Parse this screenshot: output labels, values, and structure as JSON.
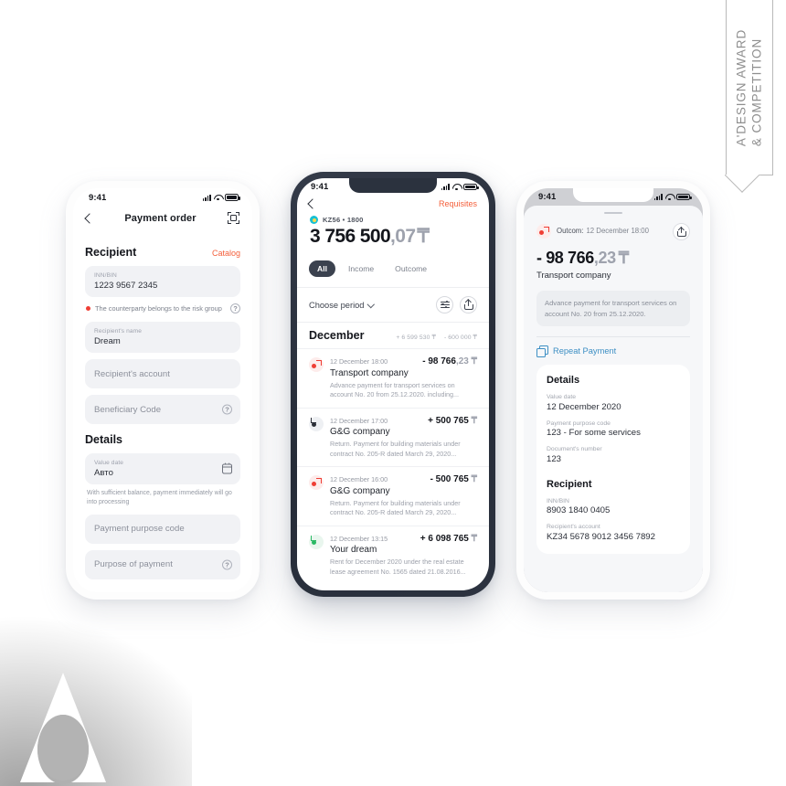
{
  "award": {
    "ribbon_line1": "A'DESIGN AWARD",
    "ribbon_line2": "& COMPETITION"
  },
  "phone_left": {
    "status": {
      "time": "9:41",
      "signal_icon": "signal-icon",
      "wifi_icon": "wifi-icon",
      "battery_icon": "battery-icon"
    },
    "navbar": {
      "back_icon": "chevron-left-icon",
      "title": "Payment order",
      "scan_icon": "scan-frame-icon"
    },
    "recipient": {
      "title": "Recipient",
      "action": "Catalog",
      "inn_label": "INN/BIN",
      "inn_value": "1223 9567 2345",
      "risk_text": "The counterparty belongs to the risk group",
      "risk_help_icon": "question-icon",
      "name_label": "Recipient's name",
      "name_value": "Dream",
      "account_placeholder": "Recipient's account",
      "beneficiary_placeholder": "Beneficiary Code",
      "beneficiary_help_icon": "question-icon"
    },
    "details": {
      "title": "Details",
      "value_date_label": "Value date",
      "value_date_value": "Авто",
      "calendar_icon": "calendar-icon",
      "hint": "With sufficient balance, payment immediately will go into processing",
      "purpose_code_placeholder": "Payment purpose code",
      "purpose_placeholder": "Purpose of payment",
      "purpose_help_icon": "question-icon"
    }
  },
  "phone_center": {
    "status": {
      "time": "9:41"
    },
    "navbar": {
      "back_icon": "chevron-left-icon",
      "requisites": "Requisites"
    },
    "account": {
      "badge_icon": "account-dot-icon",
      "name": "KZ56 • 1800",
      "balance_int": "3 756 500",
      "balance_dec": ",07",
      "currency": "₸"
    },
    "segments": [
      {
        "label": "All",
        "active": true
      },
      {
        "label": "Income",
        "active": false
      },
      {
        "label": "Outcome",
        "active": false
      }
    ],
    "period": {
      "label": "Choose period",
      "chevron_icon": "chevron-down-icon",
      "filter_icon": "sliders-icon",
      "share_icon": "share-upload-icon"
    },
    "month": {
      "name": "December",
      "income_total": "+ 6 599 530 ₸",
      "outcome_total": "- 600 000 ₸"
    },
    "transactions": [
      {
        "direction": "out",
        "time": "12 December 18:00",
        "amount_main": "- 98 766",
        "amount_dec": ",23",
        "currency": "₸",
        "name": "Transport company",
        "description": "Advance payment for transport services on account No. 20 from 25.12.2020. including..."
      },
      {
        "direction": "in",
        "time": "12 December 17:00",
        "amount_main": "+ 500 765",
        "amount_dec": "",
        "currency": "₸",
        "name": "G&G company",
        "description": "Return. Payment for building materials under contract No. 205-R dated March 29, 2020..."
      },
      {
        "direction": "out",
        "time": "12 December 16:00",
        "amount_main": "- 500 765",
        "amount_dec": "",
        "currency": "₸",
        "name": "G&G company",
        "description": "Return. Payment for building materials under contract No. 205-R dated March 29, 2020..."
      },
      {
        "direction": "in-green",
        "time": "12 December 13:15",
        "amount_main": "+ 6 098 765",
        "amount_dec": "",
        "currency": "₸",
        "name": "Your dream",
        "description": "Rent for December 2020 under the real estate lease agreement No. 1565 dated 21.08.2016..."
      }
    ]
  },
  "phone_right": {
    "status": {
      "time": "9:41"
    },
    "header": {
      "direction_icon": "outcome-arrow-icon",
      "label": "Outcom:",
      "datetime": "12 December 18:00",
      "share_icon": "share-upload-icon"
    },
    "amount_main": "- 98 766",
    "amount_dec": ",23",
    "currency": "₸",
    "counterparty": "Transport company",
    "note": "Advance payment for transport services on account No. 20 from 25.12.2020.",
    "repeat": {
      "icon": "copy-icon",
      "label": "Repeat Payment"
    },
    "details": {
      "title": "Details",
      "rows": [
        {
          "key": "Value date",
          "value": "12 December 2020"
        },
        {
          "key": "Payment purpose code",
          "value": "123 - For some services"
        },
        {
          "key": "Document's number",
          "value": "123"
        }
      ]
    },
    "recipient": {
      "title": "Recipient",
      "rows": [
        {
          "key": "INN/BIN",
          "value": "8903 1840 0405"
        },
        {
          "key": "Recipient's account",
          "value": "KZ34 5678 9012 3456 7892"
        }
      ]
    }
  },
  "colors": {
    "accent_orange": "#f4603c",
    "danger_red": "#ef3e35",
    "green": "#2ab964",
    "blue_link": "#3d8fc4",
    "dark_frame": "#2b323e"
  }
}
